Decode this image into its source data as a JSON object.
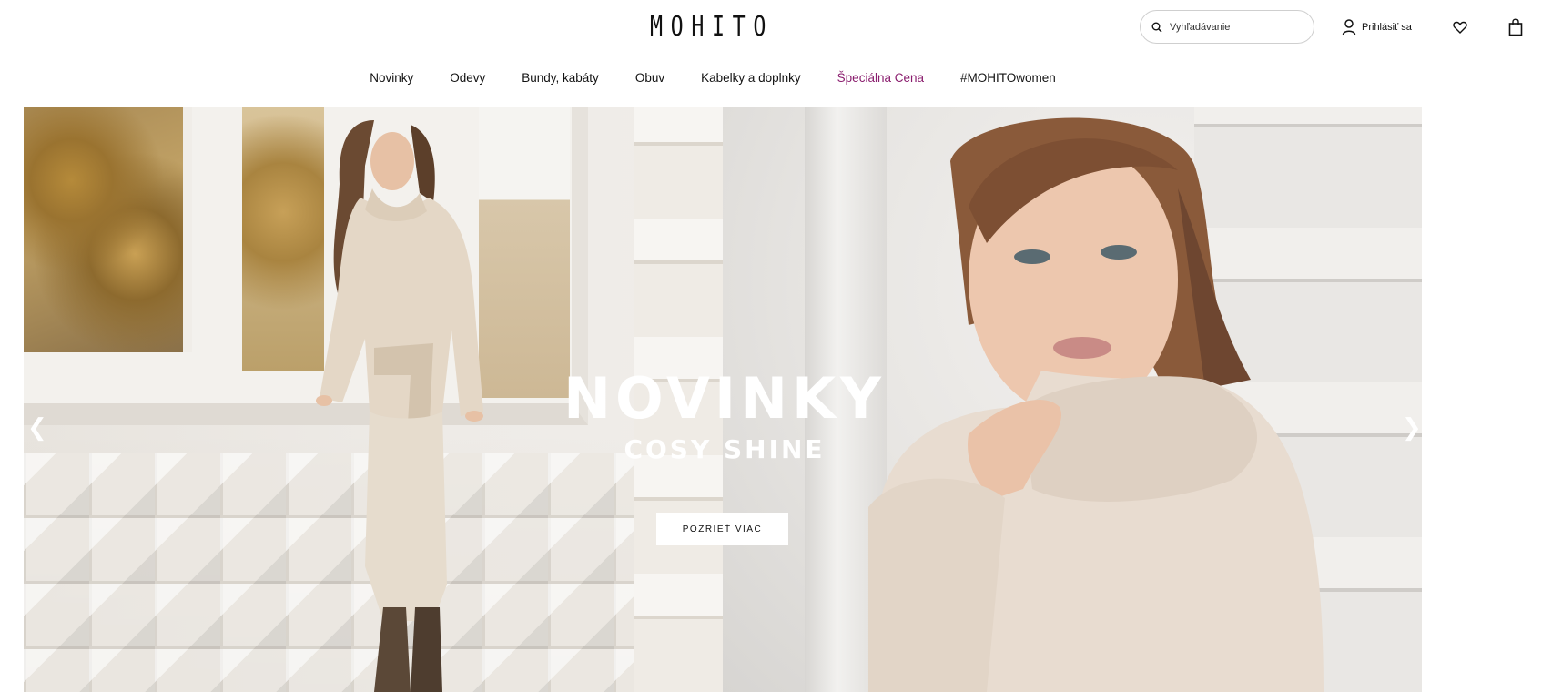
{
  "header": {
    "logo": "MOHITO",
    "search_placeholder": "Vyhľadávanie",
    "login_label": "Prihlásiť sa"
  },
  "nav": {
    "items": [
      {
        "label": "Novinky"
      },
      {
        "label": "Odevy"
      },
      {
        "label": "Bundy, kabáty"
      },
      {
        "label": "Obuv"
      },
      {
        "label": "Kabelky a doplnky"
      },
      {
        "label": "Špeciálna Cena"
      },
      {
        "label": "#MOHITOwomen"
      }
    ],
    "special_color": "#8a1d6e"
  },
  "hero": {
    "title": "NOVINKY",
    "subtitle": "COSY SHINE",
    "cta_label": "POZRIEŤ VIAC",
    "prev_arrow": "❮",
    "next_arrow": "❯"
  },
  "icons": {
    "search": "search-icon",
    "user": "user-icon",
    "wishlist": "heart-icon",
    "cart": "bag-icon"
  }
}
